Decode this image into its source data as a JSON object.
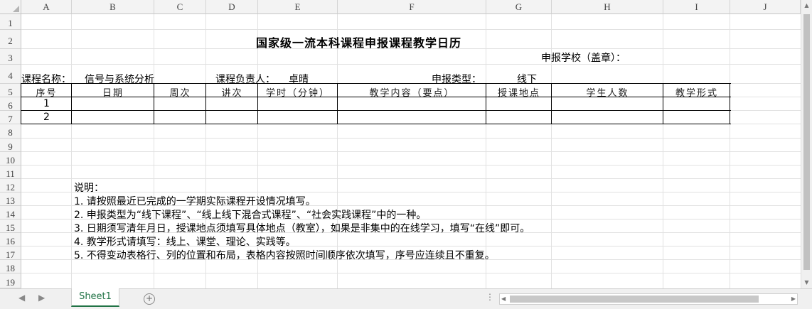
{
  "columns": [
    "A",
    "B",
    "C",
    "D",
    "E",
    "F",
    "G",
    "H",
    "I",
    "J"
  ],
  "rows": [
    "1",
    "2",
    "3",
    "4",
    "5",
    "6",
    "7",
    "8",
    "9",
    "10",
    "11",
    "12",
    "13",
    "14",
    "15",
    "16",
    "17",
    "18",
    "19"
  ],
  "title": "国家级一流本科课程申报课程教学日历",
  "school_label": "申报学校（盖章）：",
  "info": {
    "course_name_label": "课程名称：",
    "course_name": "信号与系统分析",
    "leader_label": "课程负责人：",
    "leader": "卓晴",
    "type_label": "申报类型：",
    "type": "线下"
  },
  "table": {
    "headers": [
      "序号",
      "日期",
      "周次",
      "讲次",
      "学时（分钟）",
      "教学内容（要点）",
      "授课地点",
      "学生人数",
      "教学形式"
    ],
    "rows": [
      [
        "1",
        "",
        "",
        "",
        "",
        "",
        "",
        "",
        ""
      ],
      [
        "2",
        "",
        "",
        "",
        "",
        "",
        "",
        "",
        ""
      ]
    ]
  },
  "notes": [
    "说明：",
    "1. 请按照最近已完成的一学期实际课程开设情况填写。",
    "2. 申报类型为“线下课程”、“线上线下混合式课程”、“社会实践课程”中的一种。",
    "3. 日期须写清年月日，授课地点须填写具体地点（教室），如果是非集中的在线学习，填写“在线”即可。",
    "4. 教学形式请填写：线上、课堂、理论、实践等。",
    "5. 不得变动表格行、列的位置和布局，表格内容按照时间顺序依次填写，序号应连续且不重复。"
  ],
  "sheet_tab": "Sheet1"
}
